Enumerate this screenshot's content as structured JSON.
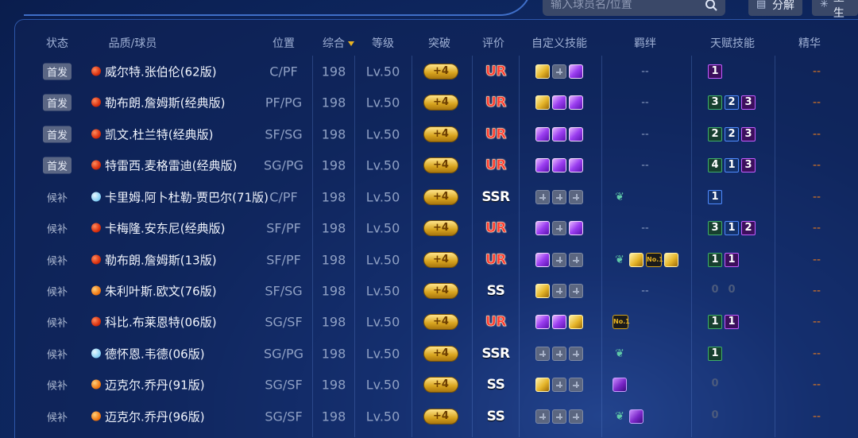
{
  "search": {
    "placeholder": "输入球员名/位置"
  },
  "buttons": {
    "decompose": "分解",
    "rebirth": "重生"
  },
  "headers": {
    "status": "状态",
    "player": "品质/球员",
    "position": "位置",
    "overall": "综合",
    "level": "等级",
    "breakthrough": "突破",
    "rating": "评价",
    "custom_skills": "自定义技能",
    "bonds": "羁绊",
    "talents": "天赋技能",
    "essence": "精华"
  },
  "rows": [
    {
      "status": "首发",
      "starter": true,
      "grade": "ur",
      "name": "威尔特.张伯伦(62版)",
      "position": "C/PF",
      "overall": "198",
      "level": "Lv.50",
      "break": "+4",
      "rating": "UR",
      "skills": [
        "gold",
        "empty",
        "purple"
      ],
      "bonds": "--",
      "talents": [
        {
          "v": "1",
          "c": "p"
        }
      ],
      "essence": "--"
    },
    {
      "status": "首发",
      "starter": true,
      "grade": "ur",
      "name": "勒布朗.詹姆斯(经典版)",
      "position": "PF/PG",
      "overall": "198",
      "level": "Lv.50",
      "break": "+4",
      "rating": "UR",
      "skills": [
        "gold",
        "purple",
        "purple"
      ],
      "bonds": "--",
      "talents": [
        {
          "v": "3",
          "c": "g"
        },
        {
          "v": "2",
          "c": "b"
        },
        {
          "v": "3",
          "c": "p"
        }
      ],
      "essence": "--"
    },
    {
      "status": "首发",
      "starter": true,
      "grade": "ur",
      "name": "凯文.杜兰特(经典版)",
      "position": "SF/SG",
      "overall": "198",
      "level": "Lv.50",
      "break": "+4",
      "rating": "UR",
      "skills": [
        "purple",
        "purple",
        "purple"
      ],
      "bonds": "--",
      "talents": [
        {
          "v": "2",
          "c": "g"
        },
        {
          "v": "2",
          "c": "b"
        },
        {
          "v": "3",
          "c": "p"
        }
      ],
      "essence": "--"
    },
    {
      "status": "首发",
      "starter": true,
      "grade": "ur",
      "name": "特雷西.麦格雷迪(经典版)",
      "position": "SG/PG",
      "overall": "198",
      "level": "Lv.50",
      "break": "+4",
      "rating": "UR",
      "skills": [
        "purple",
        "purple",
        "purple"
      ],
      "bonds": "--",
      "talents": [
        {
          "v": "4",
          "c": "g"
        },
        {
          "v": "1",
          "c": "b"
        },
        {
          "v": "3",
          "c": "p"
        }
      ],
      "essence": "--"
    },
    {
      "status": "候补",
      "starter": false,
      "grade": "ssr",
      "name": "卡里姆.阿卜杜勒-贾巴尔(71版)",
      "position": "C/PF",
      "overall": "198",
      "level": "Lv.50",
      "break": "+4",
      "rating": "SSR",
      "skills": [
        "empty",
        "empty",
        "empty"
      ],
      "bonds": "teal",
      "talents": [
        {
          "v": "1",
          "c": "b"
        }
      ],
      "essence": "--"
    },
    {
      "status": "候补",
      "starter": false,
      "grade": "ur",
      "name": "卡梅隆.安东尼(经典版)",
      "position": "SF/PF",
      "overall": "198",
      "level": "Lv.50",
      "break": "+4",
      "rating": "UR",
      "skills": [
        "purple",
        "empty",
        "purple"
      ],
      "bonds": "--",
      "talents": [
        {
          "v": "3",
          "c": "g"
        },
        {
          "v": "1",
          "c": "b"
        },
        {
          "v": "2",
          "c": "p"
        }
      ],
      "essence": "--"
    },
    {
      "status": "候补",
      "starter": false,
      "grade": "ur",
      "name": "勒布朗.詹姆斯(13版)",
      "position": "SF/PF",
      "overall": "198",
      "level": "Lv.50",
      "break": "+4",
      "rating": "UR",
      "skills": [
        "purple",
        "empty",
        "empty"
      ],
      "bonds": "teal-gold-nb1-gold",
      "talents": [
        {
          "v": "1",
          "c": "g"
        },
        {
          "v": "1",
          "c": "p"
        }
      ],
      "essence": "--"
    },
    {
      "status": "候补",
      "starter": false,
      "grade": "ss",
      "name": "朱利叶斯.欧文(76版)",
      "position": "SF/SG",
      "overall": "198",
      "level": "Lv.50",
      "break": "+4",
      "rating": "SS",
      "skills": [
        "gold",
        "empty",
        "empty"
      ],
      "bonds": "--",
      "talents": [
        {
          "v": "0",
          "c": "dim"
        },
        {
          "v": "0",
          "c": "dim"
        }
      ],
      "essence": "--"
    },
    {
      "status": "候补",
      "starter": false,
      "grade": "ur",
      "name": "科比.布莱恩特(06版)",
      "position": "SG/SF",
      "overall": "198",
      "level": "Lv.50",
      "break": "+4",
      "rating": "UR",
      "skills": [
        "purple",
        "purple",
        "gold"
      ],
      "bonds": "nb1",
      "talents": [
        {
          "v": "1",
          "c": "g"
        },
        {
          "v": "1",
          "c": "p"
        }
      ],
      "essence": "--"
    },
    {
      "status": "候补",
      "starter": false,
      "grade": "ssr",
      "name": "德怀恩.韦德(06版)",
      "position": "SG/PG",
      "overall": "198",
      "level": "Lv.50",
      "break": "+4",
      "rating": "SSR",
      "skills": [
        "empty",
        "empty",
        "empty"
      ],
      "bonds": "teal",
      "talents": [
        {
          "v": "1",
          "c": "g"
        }
      ],
      "essence": "--"
    },
    {
      "status": "候补",
      "starter": false,
      "grade": "ss",
      "name": "迈克尔.乔丹(91版)",
      "position": "SG/SF",
      "overall": "198",
      "level": "Lv.50",
      "break": "+4",
      "rating": "SS",
      "skills": [
        "gold",
        "empty",
        "empty"
      ],
      "bonds": "purple",
      "talents": [
        {
          "v": "0",
          "c": "dim"
        }
      ],
      "essence": "--"
    },
    {
      "status": "候补",
      "starter": false,
      "grade": "ss",
      "name": "迈克尔.乔丹(96版)",
      "position": "SG/SF",
      "overall": "198",
      "level": "Lv.50",
      "break": "+4",
      "rating": "SS",
      "skills": [
        "empty",
        "empty",
        "empty"
      ],
      "bonds": "teal-purple",
      "talents": [
        {
          "v": "0",
          "c": "dim"
        }
      ],
      "essence": "--"
    }
  ]
}
